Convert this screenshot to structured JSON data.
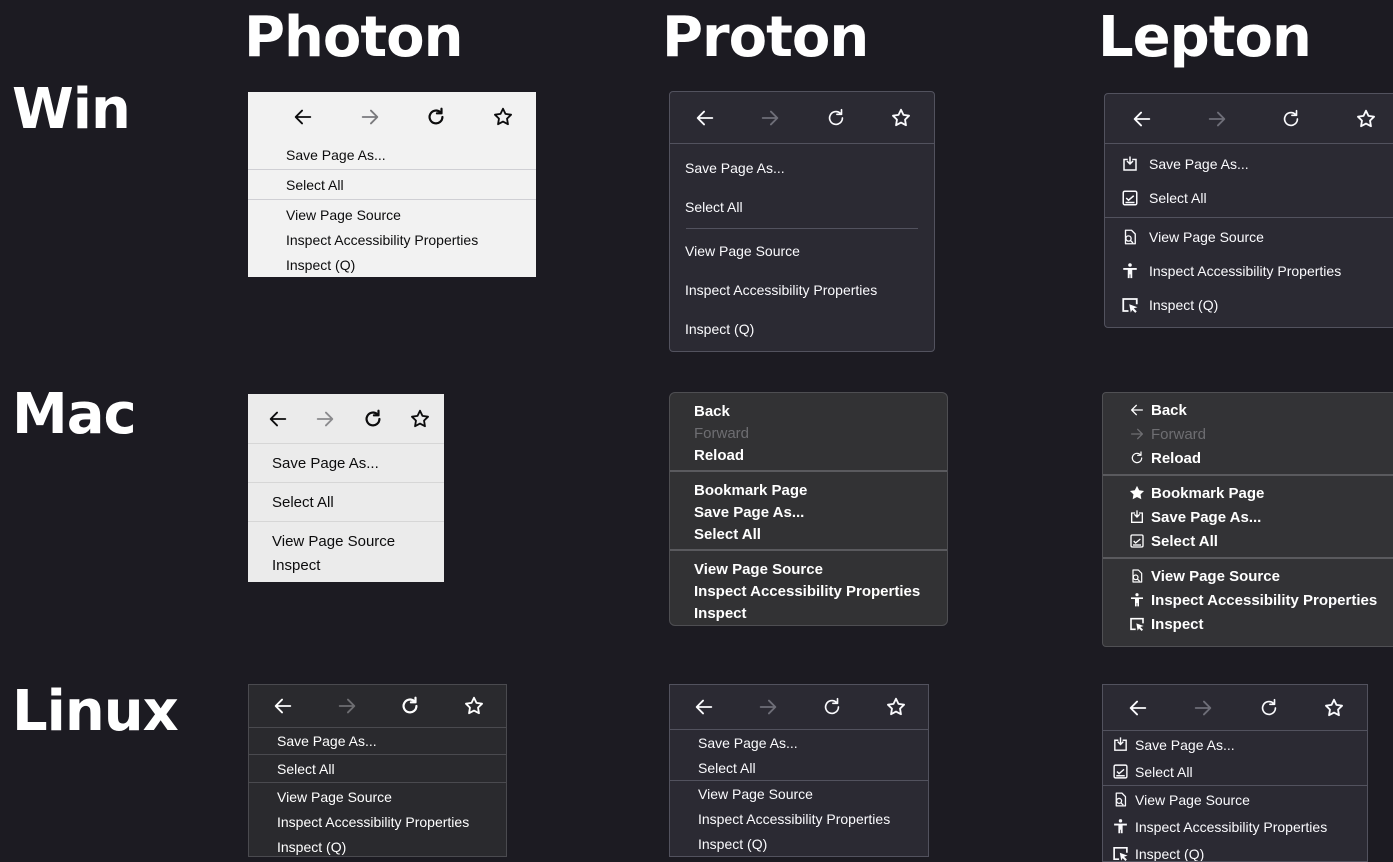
{
  "columns": {
    "photon": "Photon",
    "proton": "Proton",
    "lepton": "Lepton"
  },
  "rows": {
    "win": "Win",
    "mac": "Mac",
    "linux": "Linux"
  },
  "items": {
    "save_page": "Save Page As...",
    "select_all": "Select All",
    "view_source": "View Page Source",
    "inspect_a11y": "Inspect Accessibility Properties",
    "inspect_q": "Inspect (Q)",
    "inspect": "Inspect",
    "back": "Back",
    "forward": "Forward",
    "reload": "Reload",
    "bookmark": "Bookmark Page"
  },
  "icons": [
    "back-arrow-icon",
    "forward-arrow-icon",
    "reload-icon",
    "star-icon",
    "save-page-icon",
    "select-all-icon",
    "view-source-icon",
    "accessibility-icon",
    "inspect-icon"
  ],
  "colors": {
    "background": "#1c1b22",
    "photon_light": "#f2f2f2",
    "proton_dark": "#2b2a33",
    "mac_dark": "#323234",
    "disabled": "#6e6e72"
  }
}
